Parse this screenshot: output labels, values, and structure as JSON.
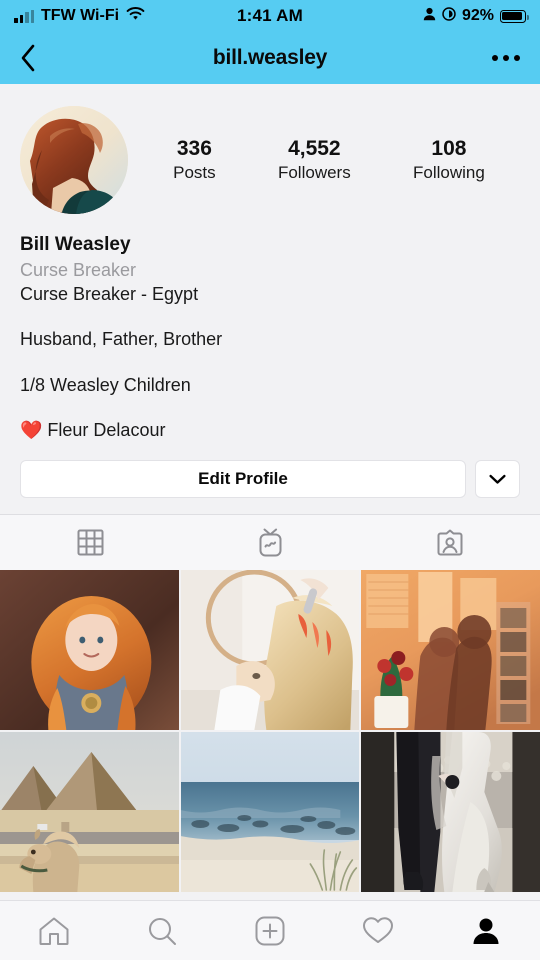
{
  "status_bar": {
    "carrier": "TFW Wi-Fi",
    "time": "1:41 AM",
    "battery_percent": "92%",
    "signal_icon": "cellular-signal-icon",
    "wifi_icon": "wifi-icon",
    "person_icon": "person-icon",
    "lock_icon": "rotation-lock-icon",
    "battery_icon": "battery-icon"
  },
  "header": {
    "title": "bill.weasley",
    "back_icon": "chevron-left-icon",
    "more_icon": "more-options-icon",
    "background_color": "#56ccf2"
  },
  "profile": {
    "avatar_alt": "profile-photo",
    "stats": [
      {
        "value": "336",
        "label": "Posts"
      },
      {
        "value": "4,552",
        "label": "Followers"
      },
      {
        "value": "108",
        "label": "Following"
      }
    ],
    "name": "Bill Weasley",
    "category": "Curse Breaker",
    "bio_lines": [
      "Curse Breaker - Egypt",
      "Husband, Father, Brother",
      "1/8 Weasley Children",
      "❤️ Fleur Delacour"
    ],
    "edit_profile_label": "Edit Profile",
    "dropdown_icon": "chevron-down-icon"
  },
  "tabs": [
    {
      "name": "grid-tab",
      "icon": "grid-icon",
      "active": true
    },
    {
      "name": "igtv-tab",
      "icon": "igtv-icon",
      "active": false
    },
    {
      "name": "tagged-tab",
      "icon": "tagged-person-icon",
      "active": false
    }
  ],
  "posts": [
    {
      "name": "post-red-haired-girl",
      "description": "Red-haired girl in gray shirt"
    },
    {
      "name": "post-hair-styling",
      "description": "Blonde hair styling in bathroom mirror"
    },
    {
      "name": "post-couple-silhouette",
      "description": "Couple silhouette with tulips at sunset"
    },
    {
      "name": "post-pyramids-camel",
      "description": "Pyramids of Giza with camel"
    },
    {
      "name": "post-beach-ocean",
      "description": "Beach and ocean with dune grass"
    },
    {
      "name": "post-wedding-couple",
      "description": "Wedding couple walking"
    }
  ],
  "bottom_nav": [
    {
      "name": "nav-home",
      "icon": "home-icon",
      "active": false
    },
    {
      "name": "nav-search",
      "icon": "search-icon",
      "active": false
    },
    {
      "name": "nav-add",
      "icon": "add-post-icon",
      "active": false
    },
    {
      "name": "nav-activity",
      "icon": "heart-icon",
      "active": false
    },
    {
      "name": "nav-profile",
      "icon": "person-filled-icon",
      "active": true
    }
  ]
}
